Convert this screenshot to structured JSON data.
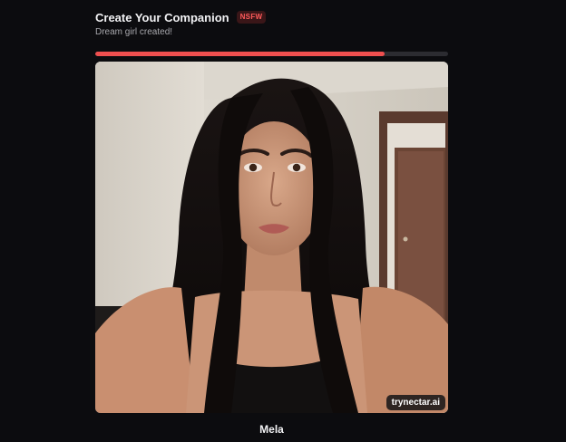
{
  "header": {
    "title": "Create Your Companion",
    "badge": "NSFW",
    "subtitle": "Dream girl created!"
  },
  "progress": {
    "fraction": 0.82,
    "color": "#ef4f4f"
  },
  "image": {
    "watermark": "trynectar.ai"
  },
  "companion": {
    "name": "Mela"
  },
  "colors": {
    "background": "#0c0c0f",
    "accent": "#ef4f4f"
  }
}
